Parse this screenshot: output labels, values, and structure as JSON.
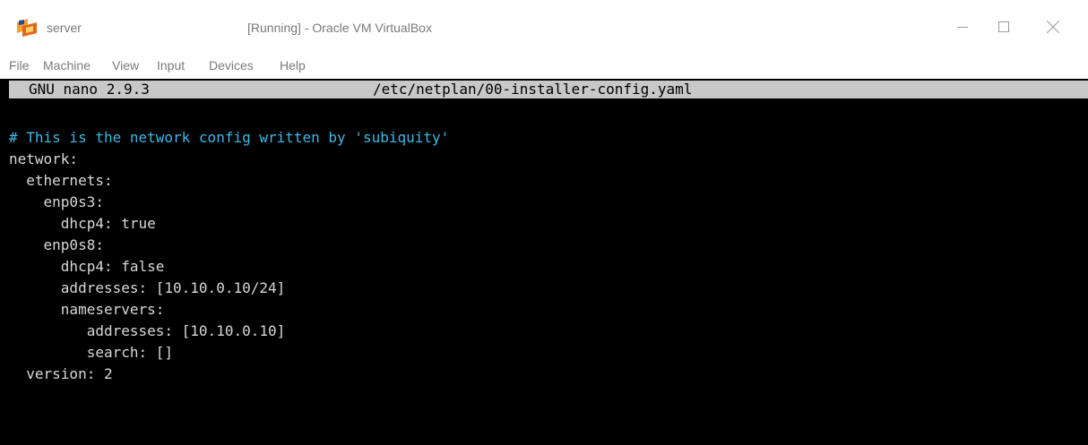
{
  "window": {
    "vm_name": "server",
    "title": "[Running] - Oracle VM VirtualBox"
  },
  "menu": [
    "File",
    "Machine",
    "View",
    "Input",
    "Devices",
    "Help"
  ],
  "nano": {
    "version": "GNU nano 2.9.3",
    "filename": "/etc/netplan/00-installer-config.yaml"
  },
  "file_lines": [
    "# This is the network config written by 'subiquity'",
    "network:",
    "  ethernets:",
    "    enp0s3:",
    "      dhcp4: true",
    "    enp0s8:",
    "      dhcp4: false",
    "      addresses: [10.10.0.10/24]",
    "      nameservers:",
    "         addresses: [10.10.0.10]",
    "         search: []",
    "  version: 2"
  ],
  "colors": {
    "comment": "#3fb7e8",
    "text": "#d8d8d8",
    "header_bg": "#c8c8c8",
    "terminal_bg": "#000000"
  },
  "icons": {
    "app": "virtualbox-icon",
    "minimize": "minimize-icon",
    "maximize": "maximize-icon",
    "close": "close-icon"
  }
}
